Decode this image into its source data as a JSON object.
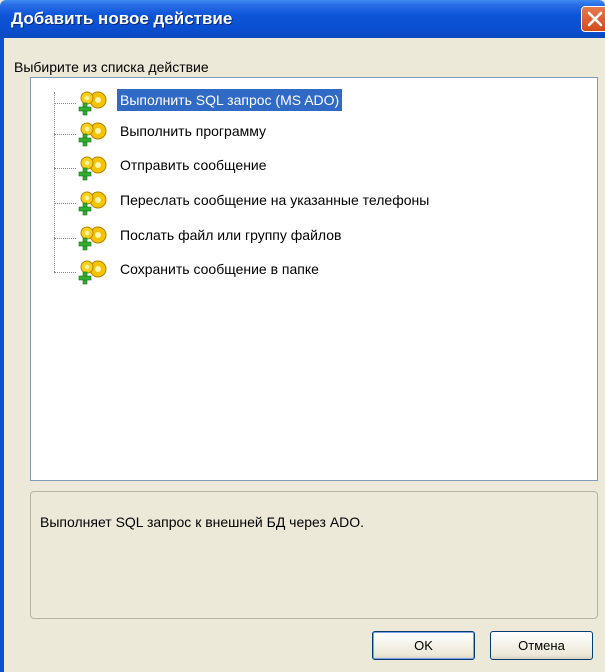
{
  "window": {
    "title": "Добавить новое действие"
  },
  "prompt_label": "Выбирите из списка действие",
  "actions": [
    {
      "label": "Выполнить SQL запрос (MS ADO)",
      "selected": true
    },
    {
      "label": "Выполнить программу",
      "selected": false
    },
    {
      "label": "Отправить сообщение",
      "selected": false
    },
    {
      "label": "Переслать сообщение на указанные телефоны",
      "selected": false
    },
    {
      "label": "Послать файл или группу файлов",
      "selected": false
    },
    {
      "label": "Сохранить сообщение в папке",
      "selected": false
    }
  ],
  "description": "Выполняет SQL запрос к внешней БД через ADO.",
  "buttons": {
    "ok_label": "OK",
    "cancel_label": "Отмена"
  },
  "icons": {
    "action_icon": "gear-plus-icon",
    "close_icon": "close-icon"
  },
  "colors": {
    "title_bar": "#0a4fd0",
    "selection": "#316ac5",
    "close_button": "#d44a1c",
    "gear": "#f5c400",
    "plus": "#2fae2f"
  }
}
